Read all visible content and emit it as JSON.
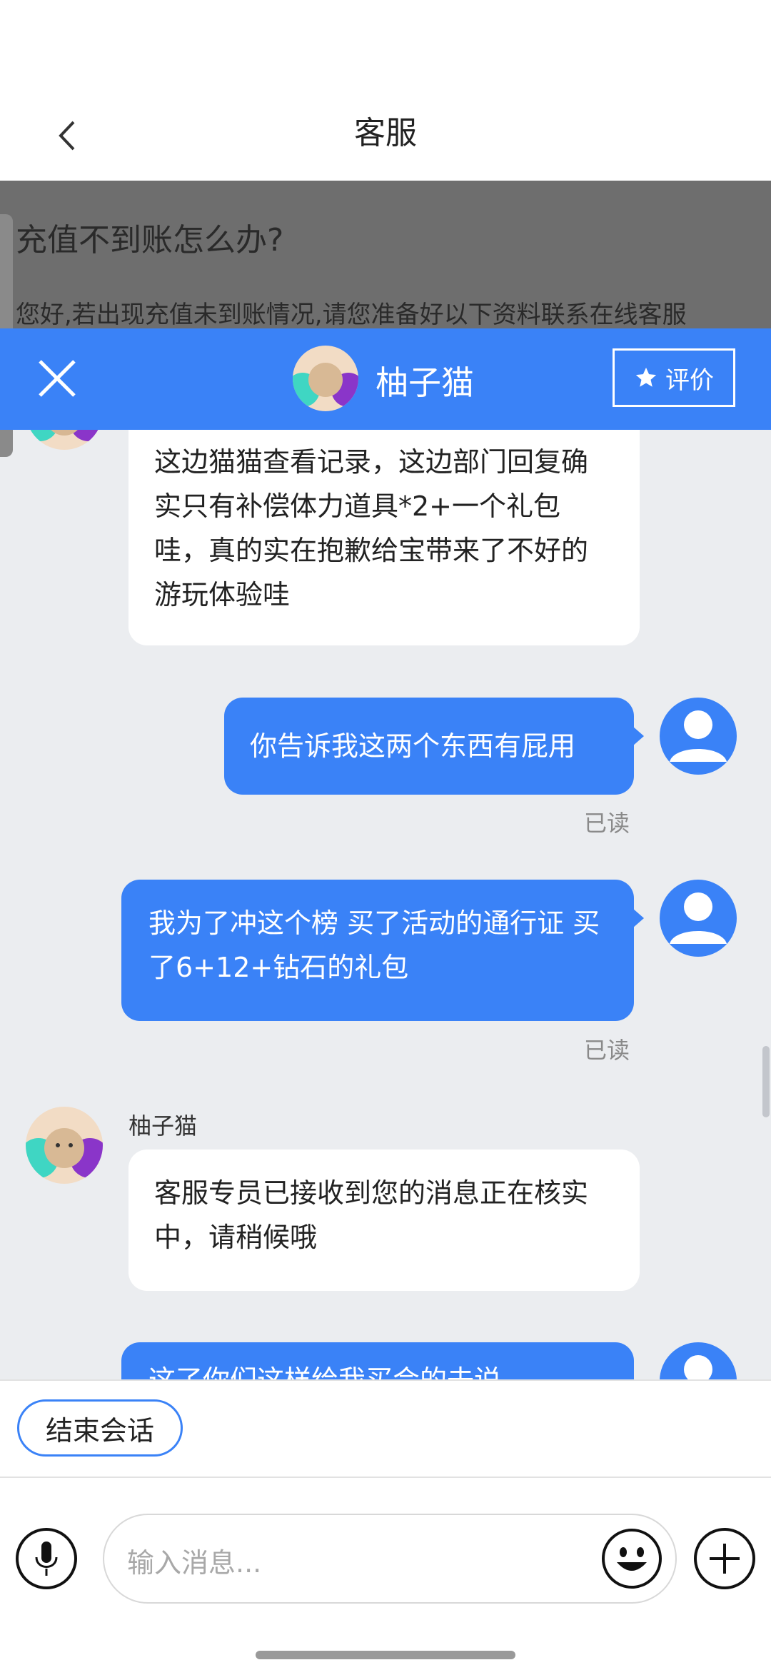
{
  "header": {
    "title": "客服",
    "back_icon": "chevron-left-icon"
  },
  "faq": {
    "question": "充值不到账怎么办?",
    "answer": "您好,若出现充值未到账情况,请您准备好以下资料联系在线客服"
  },
  "chat_header": {
    "close_icon": "close-icon",
    "agent_name": "柚子猫",
    "rate_label": "评价",
    "rate_icon": "star-icon",
    "accent": "#3a82f7"
  },
  "messages": {
    "m1_text": "这边猫猫查看记录，这边部门回复确实只有补偿体力道具*2+一个礼包哇，真的实在抱歉给宝带来了不好的游玩体验哇",
    "m2_text": "你告诉我这两个东西有屁用",
    "m2_status": "已读",
    "m3_text": "我为了冲这个榜 买了活动的通行证 买了6+12+钻石的礼包",
    "m3_status": "已读",
    "m4_sender": "柚子猫",
    "m4_text": "客服专员已接收到您的消息正在核实中，请稍候哦",
    "m5_text": "这了你们这样给我买会的去说"
  },
  "footer": {
    "end_label": "结束会话",
    "input_placeholder": "输入消息...",
    "mic_icon": "microphone-icon",
    "emoji_icon": "emoji-icon",
    "plus_icon": "plus-icon"
  }
}
